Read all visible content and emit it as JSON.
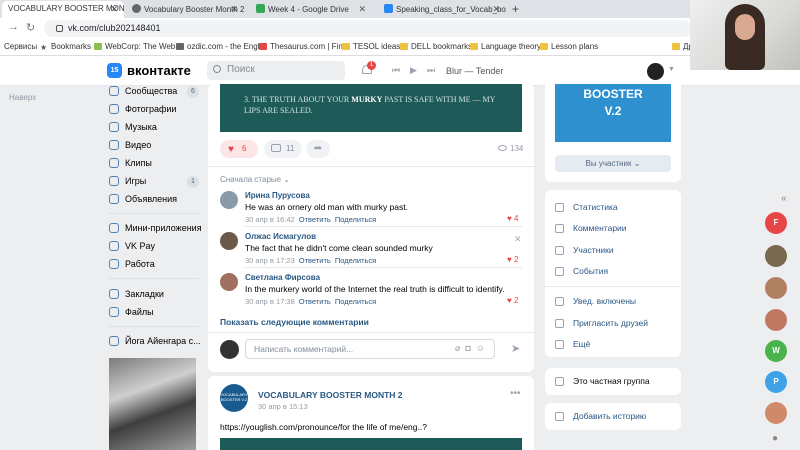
{
  "browser": {
    "tabs": [
      {
        "title": "VOCABULARY BOOSTER MONTH",
        "active": true
      },
      {
        "title": "Vocabulary Booster Month 2",
        "active": false
      },
      {
        "title": "Week 4 - Google Drive",
        "active": false
      },
      {
        "title": "Speaking_class_for_Vocab_boost",
        "active": false
      }
    ],
    "url": "vk.com/club202148401",
    "bookmarks": [
      "Сервисы",
      "Bookmarks",
      "WebCorp: The Web...",
      "ozdic.com - the Engl...",
      "Thesaurus.com | Fin...",
      "TESOL ideas",
      "DELL bookmarks",
      "Language theory",
      "Lesson plans",
      "Друг"
    ]
  },
  "header": {
    "logo_text": "15",
    "brand": "вконтакте",
    "search_placeholder": "Поиск",
    "notification_count": "1",
    "now_playing": "Blur — Tender"
  },
  "sidebar": {
    "back_label": "Наверх",
    "items": [
      {
        "label": "Сообщества",
        "count": "6"
      },
      {
        "label": "Фотографии",
        "count": ""
      },
      {
        "label": "Музыка",
        "count": ""
      },
      {
        "label": "Видео",
        "count": ""
      },
      {
        "label": "Клипы",
        "count": ""
      },
      {
        "label": "Игры",
        "count": "1"
      },
      {
        "label": "Объявления",
        "count": ""
      },
      {
        "label": "Мини-приложения",
        "count": ""
      },
      {
        "label": "VK Pay",
        "count": ""
      },
      {
        "label": "Работа",
        "count": ""
      },
      {
        "label": "Закладки",
        "count": ""
      },
      {
        "label": "Файлы",
        "count": ""
      },
      {
        "label": "Йога Айенгара с...",
        "count": ""
      }
    ]
  },
  "post": {
    "image_text_pre": "3. THE TRUTH ABOUT YOUR ",
    "image_text_bold": "MURKY",
    "image_text_post": " PAST IS SAFE WITH ME — MY LIPS ARE SEALED.",
    "likes": "6",
    "comments": "11",
    "views": "134",
    "sort_label": "Сначала старые ⌄",
    "show_more": "Показать следующие комментарии",
    "reply_placeholder": "Написать комментарий...",
    "comment_list": [
      {
        "author": "Ирина Пурусова",
        "text": "He was an ornery old man with murky past.",
        "date": "30 апр в 16:42",
        "reply": "Ответить",
        "share": "Поделиться",
        "likes": "4"
      },
      {
        "author": "Олжас Исмагулов",
        "text": "The fact that he didn't come clean sounded murky",
        "date": "30 апр в 17:23",
        "reply": "Ответить",
        "share": "Поделиться",
        "likes": "2"
      },
      {
        "author": "Светлана Фирсова",
        "text": "In the murkery world of the Internet the real truth is difficult to identify.",
        "date": "30 апр в 17:38",
        "reply": "Ответить",
        "share": "Поделиться",
        "likes": "2"
      }
    ]
  },
  "post2": {
    "logo_text": "VOCABULARY BOOSTER V.2",
    "title": "VOCABULARY BOOSTER MONTH 2",
    "date": "30 апр в 15:13",
    "link": "https://youglish.com/pronounce/for the life of me/eng..?"
  },
  "right": {
    "cover_line1": "BOOSTER",
    "cover_line2": "V.2",
    "member_button": "Вы участник ⌄",
    "menu": [
      "Статистика",
      "Комментарии",
      "Участники",
      "События"
    ],
    "menu2": [
      "Увед. включены",
      "Пригласить друзей",
      "Ещё"
    ],
    "private_group": "Это частная группа",
    "add_story": "Добавить историю"
  },
  "strip": {
    "avatars": [
      {
        "letter": "F",
        "color": "#e64646"
      },
      {
        "letter": "",
        "color": "#7a6a50"
      },
      {
        "letter": "",
        "color": "#b08060"
      },
      {
        "letter": "",
        "color": "#c07860"
      },
      {
        "letter": "W",
        "color": "#4bb34b"
      },
      {
        "letter": "P",
        "color": "#3fa2e8"
      },
      {
        "letter": "",
        "color": "#d08a6a"
      }
    ]
  }
}
